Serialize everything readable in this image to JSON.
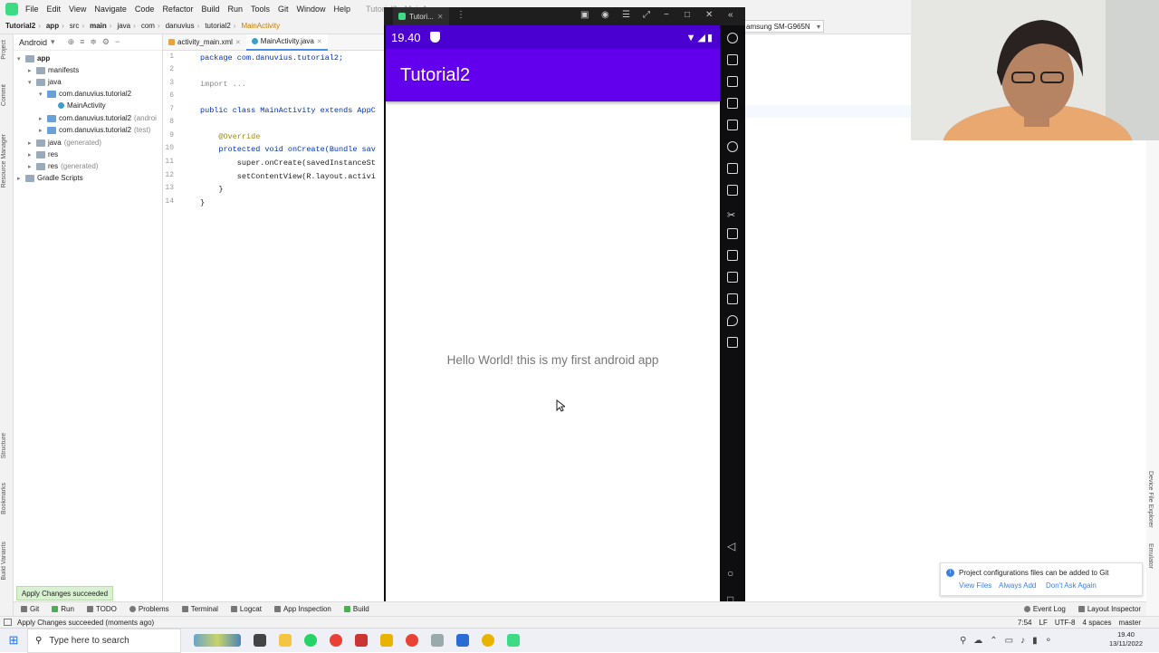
{
  "menu": {
    "items": [
      "File",
      "Edit",
      "View",
      "Navigate",
      "Code",
      "Refactor",
      "Build",
      "Run",
      "Tools",
      "Git",
      "Window",
      "Help"
    ],
    "window_title": "Tutorial2 - MainA"
  },
  "breadcrumb": [
    "Tutorial2",
    "app",
    "src",
    "main",
    "java",
    "com",
    "danuvius",
    "tutorial2",
    "MainActivity"
  ],
  "device_selector": "amsung SM-G965N",
  "left_strip": [
    "Project",
    "Commit",
    "Resource Manager",
    "Structure",
    "Bookmarks",
    "Build Variants"
  ],
  "right_strip": [
    "Device File Explorer",
    "Emulator"
  ],
  "project": {
    "mode": "Android",
    "tree": [
      {
        "label": "app",
        "level": 0,
        "bold": true
      },
      {
        "label": "manifests",
        "level": 1
      },
      {
        "label": "java",
        "level": 1
      },
      {
        "label": "com.danuvius.tutorial2",
        "level": 2
      },
      {
        "label": "MainActivity",
        "level": 3,
        "cls": true
      },
      {
        "label": "com.danuvius.tutorial2",
        "level": 2,
        "suffix": "(androi"
      },
      {
        "label": "com.danuvius.tutorial2",
        "level": 2,
        "suffix": "(test)"
      },
      {
        "label": "java",
        "level": 1,
        "suffix": "(generated)"
      },
      {
        "label": "res",
        "level": 1
      },
      {
        "label": "res",
        "level": 1,
        "suffix": "(generated)"
      },
      {
        "label": "Gradle Scripts",
        "level": 0
      }
    ]
  },
  "editor": {
    "tabs": [
      "activity_main.xml",
      "MainActivity.java"
    ],
    "line_numbers": [
      "1",
      "2",
      "3",
      "6",
      "7",
      "8",
      "9",
      "10",
      "11",
      "12",
      "13",
      "14"
    ],
    "lines": [
      "package com.danuvius.tutorial2;",
      "",
      "import ...",
      "",
      "public class MainActivity extends AppC",
      "",
      "    @Override",
      "    protected void onCreate(Bundle sav",
      "        super.onCreate(savedInstanceSt",
      "        setContentView(R.layout.activi",
      "    }",
      "}"
    ]
  },
  "bottom_tabs": [
    "Git",
    "Run",
    "TODO",
    "Problems",
    "Terminal",
    "Logcat",
    "App Inspection",
    "Build"
  ],
  "toast": "Apply Changes succeeded",
  "status": {
    "message": "Apply Changes succeeded (moments ago)",
    "right": [
      "Event Log",
      "Layout Inspector"
    ],
    "position": "7:54",
    "line_sep": "LF",
    "encoding": "UTF-8",
    "indent": "4 spaces",
    "branch": "master"
  },
  "notification": {
    "text": "Project configurations files can be added to Git",
    "actions": [
      "View Files",
      "Always Add",
      "Don't Ask Again"
    ]
  },
  "emulator": {
    "tab_title": "Tutori...",
    "phone_time": "19.40",
    "app_title": "Tutorial2",
    "hello_text": "Hello World! this is my first android app"
  },
  "taskbar": {
    "search_placeholder": "Type here to search",
    "time": "19.40",
    "date": "13/11/2022"
  },
  "colors": {
    "app_bar": "#6200ee",
    "status_bar": "#4a00d0",
    "accent": "#3d7fe0"
  }
}
